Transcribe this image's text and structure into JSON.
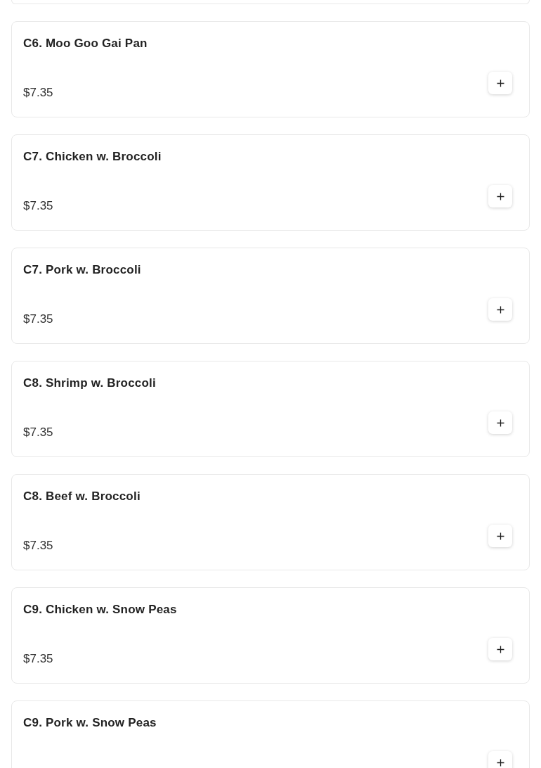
{
  "menu_items": [
    {
      "name": "C6. Moo Goo Gai Pan",
      "price": "$7.35"
    },
    {
      "name": "C7. Chicken w. Broccoli",
      "price": "$7.35"
    },
    {
      "name": "C7. Pork w. Broccoli",
      "price": "$7.35"
    },
    {
      "name": "C8. Shrimp w. Broccoli",
      "price": "$7.35"
    },
    {
      "name": "C8. Beef w. Broccoli",
      "price": "$7.35"
    },
    {
      "name": "C9. Chicken w. Snow Peas",
      "price": "$7.35"
    },
    {
      "name": "C9. Pork w. Snow Peas"
    }
  ]
}
